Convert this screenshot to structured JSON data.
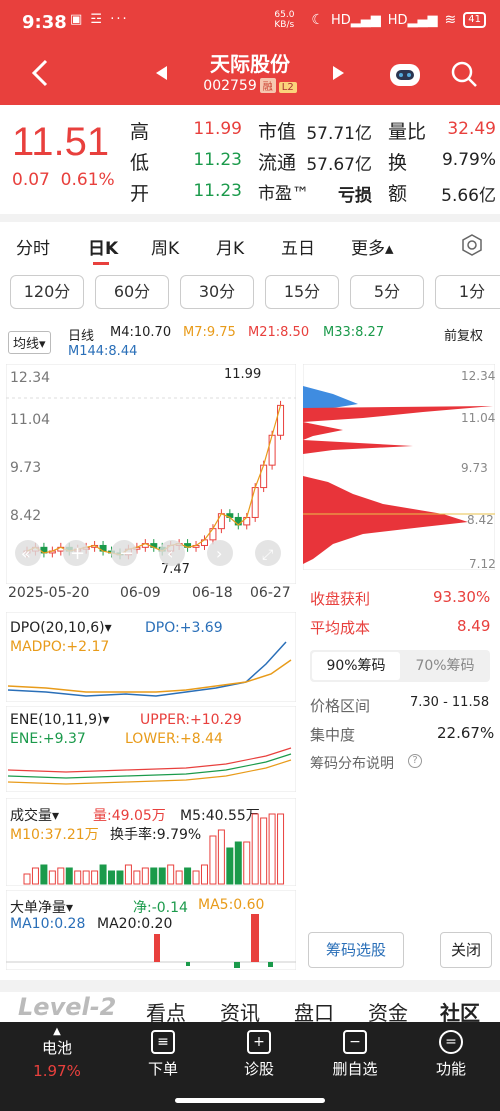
{
  "status": {
    "time": "9:38",
    "net_speed": "65.0 KB/s",
    "battery": "41"
  },
  "header": {
    "title": "天际股份",
    "code": "002759",
    "tag1": "融",
    "tag2": "L2"
  },
  "quote": {
    "price": "11.51",
    "change": "0.07",
    "change_pct": "0.61%",
    "high_label": "高",
    "high": "11.99",
    "low_label": "低",
    "low": "11.23",
    "open_label": "开",
    "open": "11.23",
    "mktcap_label": "市值",
    "mktcap": "57.71亿",
    "float_label": "流通",
    "float": "57.67亿",
    "pe_label": "市盈™",
    "pe": "亏损",
    "vol_ratio_label": "量比",
    "vol_ratio": "32.49",
    "turnover_label": "换",
    "turnover": "9.79%",
    "amount_label": "额",
    "amount": "5.66亿"
  },
  "tabs": [
    "分时",
    "日K",
    "周K",
    "月K",
    "五日",
    "更多▴"
  ],
  "periods": [
    "120分",
    "60分",
    "30分",
    "15分",
    "5分",
    "1分"
  ],
  "ma": {
    "selector": "均线▾",
    "label": "日线",
    "m4": "M4:10.70",
    "m7": "M7:9.75",
    "m21": "M21:8.50",
    "m33": "M33:8.27",
    "m144": "M144:8.44",
    "adj": "前复权"
  },
  "kline": {
    "y_ticks": [
      "12.34",
      "11.04",
      "9.73",
      "8.42",
      "7.12"
    ],
    "high_mark": "11.99",
    "low_mark": "7.47",
    "dates": [
      "2025-05-20",
      "06-09",
      "06-18",
      "06-27"
    ],
    "closes": [
      7.6,
      7.7,
      7.55,
      7.6,
      7.7,
      7.6,
      7.65,
      7.7,
      7.75,
      7.6,
      7.55,
      7.5,
      7.65,
      7.7,
      7.8,
      7.7,
      7.6,
      7.75,
      7.8,
      7.7,
      7.75,
      7.9,
      8.2,
      8.6,
      8.5,
      8.3,
      8.5,
      9.3,
      9.9,
      10.7,
      11.5
    ],
    "colors": {
      "up": "#e8403d",
      "down": "#1b9a4b"
    }
  },
  "dpo": {
    "title": "DPO(20,10,6)▾",
    "dpo": "DPO:+3.69",
    "madpo": "MADPO:+2.17"
  },
  "ene": {
    "title": "ENE(10,11,9)▾",
    "upper": "UPPER:+10.29",
    "ene": "ENE:+9.37",
    "lower": "LOWER:+8.44"
  },
  "vol": {
    "title": "成交量▾",
    "vol": "量:49.05万",
    "m5": "M5:40.55万",
    "m10": "M10:37.21万",
    "turnover": "换手率:9.79%"
  },
  "bigorder": {
    "title": "大单净量▾",
    "net": "净:-0.14",
    "ma5": "MA5:0.60",
    "ma10": "MA10:0.28",
    "ma20": "MA20:0.20"
  },
  "chips": {
    "y_ticks": [
      "12.34",
      "11.04",
      "9.73",
      "8.42",
      "7.12"
    ],
    "profit_label": "收盘获利",
    "profit": "93.30%",
    "cost_label": "平均成本",
    "cost": "8.49",
    "tab90": "90%筹码",
    "tab70": "70%筹码",
    "range_label": "价格区间",
    "range": "7.30 - 11.58",
    "conc_label": "集中度",
    "conc": "22.67%",
    "explain": "筹码分布说明",
    "select_btn": "筹码选股",
    "close_btn": "关闭"
  },
  "bottom_tabs": [
    "Level-2",
    "看点",
    "资讯",
    "盘口",
    "资金",
    "社区"
  ],
  "nav": {
    "battery_label": "电池",
    "battery_pct": "1.97%",
    "items": [
      "下单",
      "诊股",
      "删自选",
      "功能"
    ]
  }
}
